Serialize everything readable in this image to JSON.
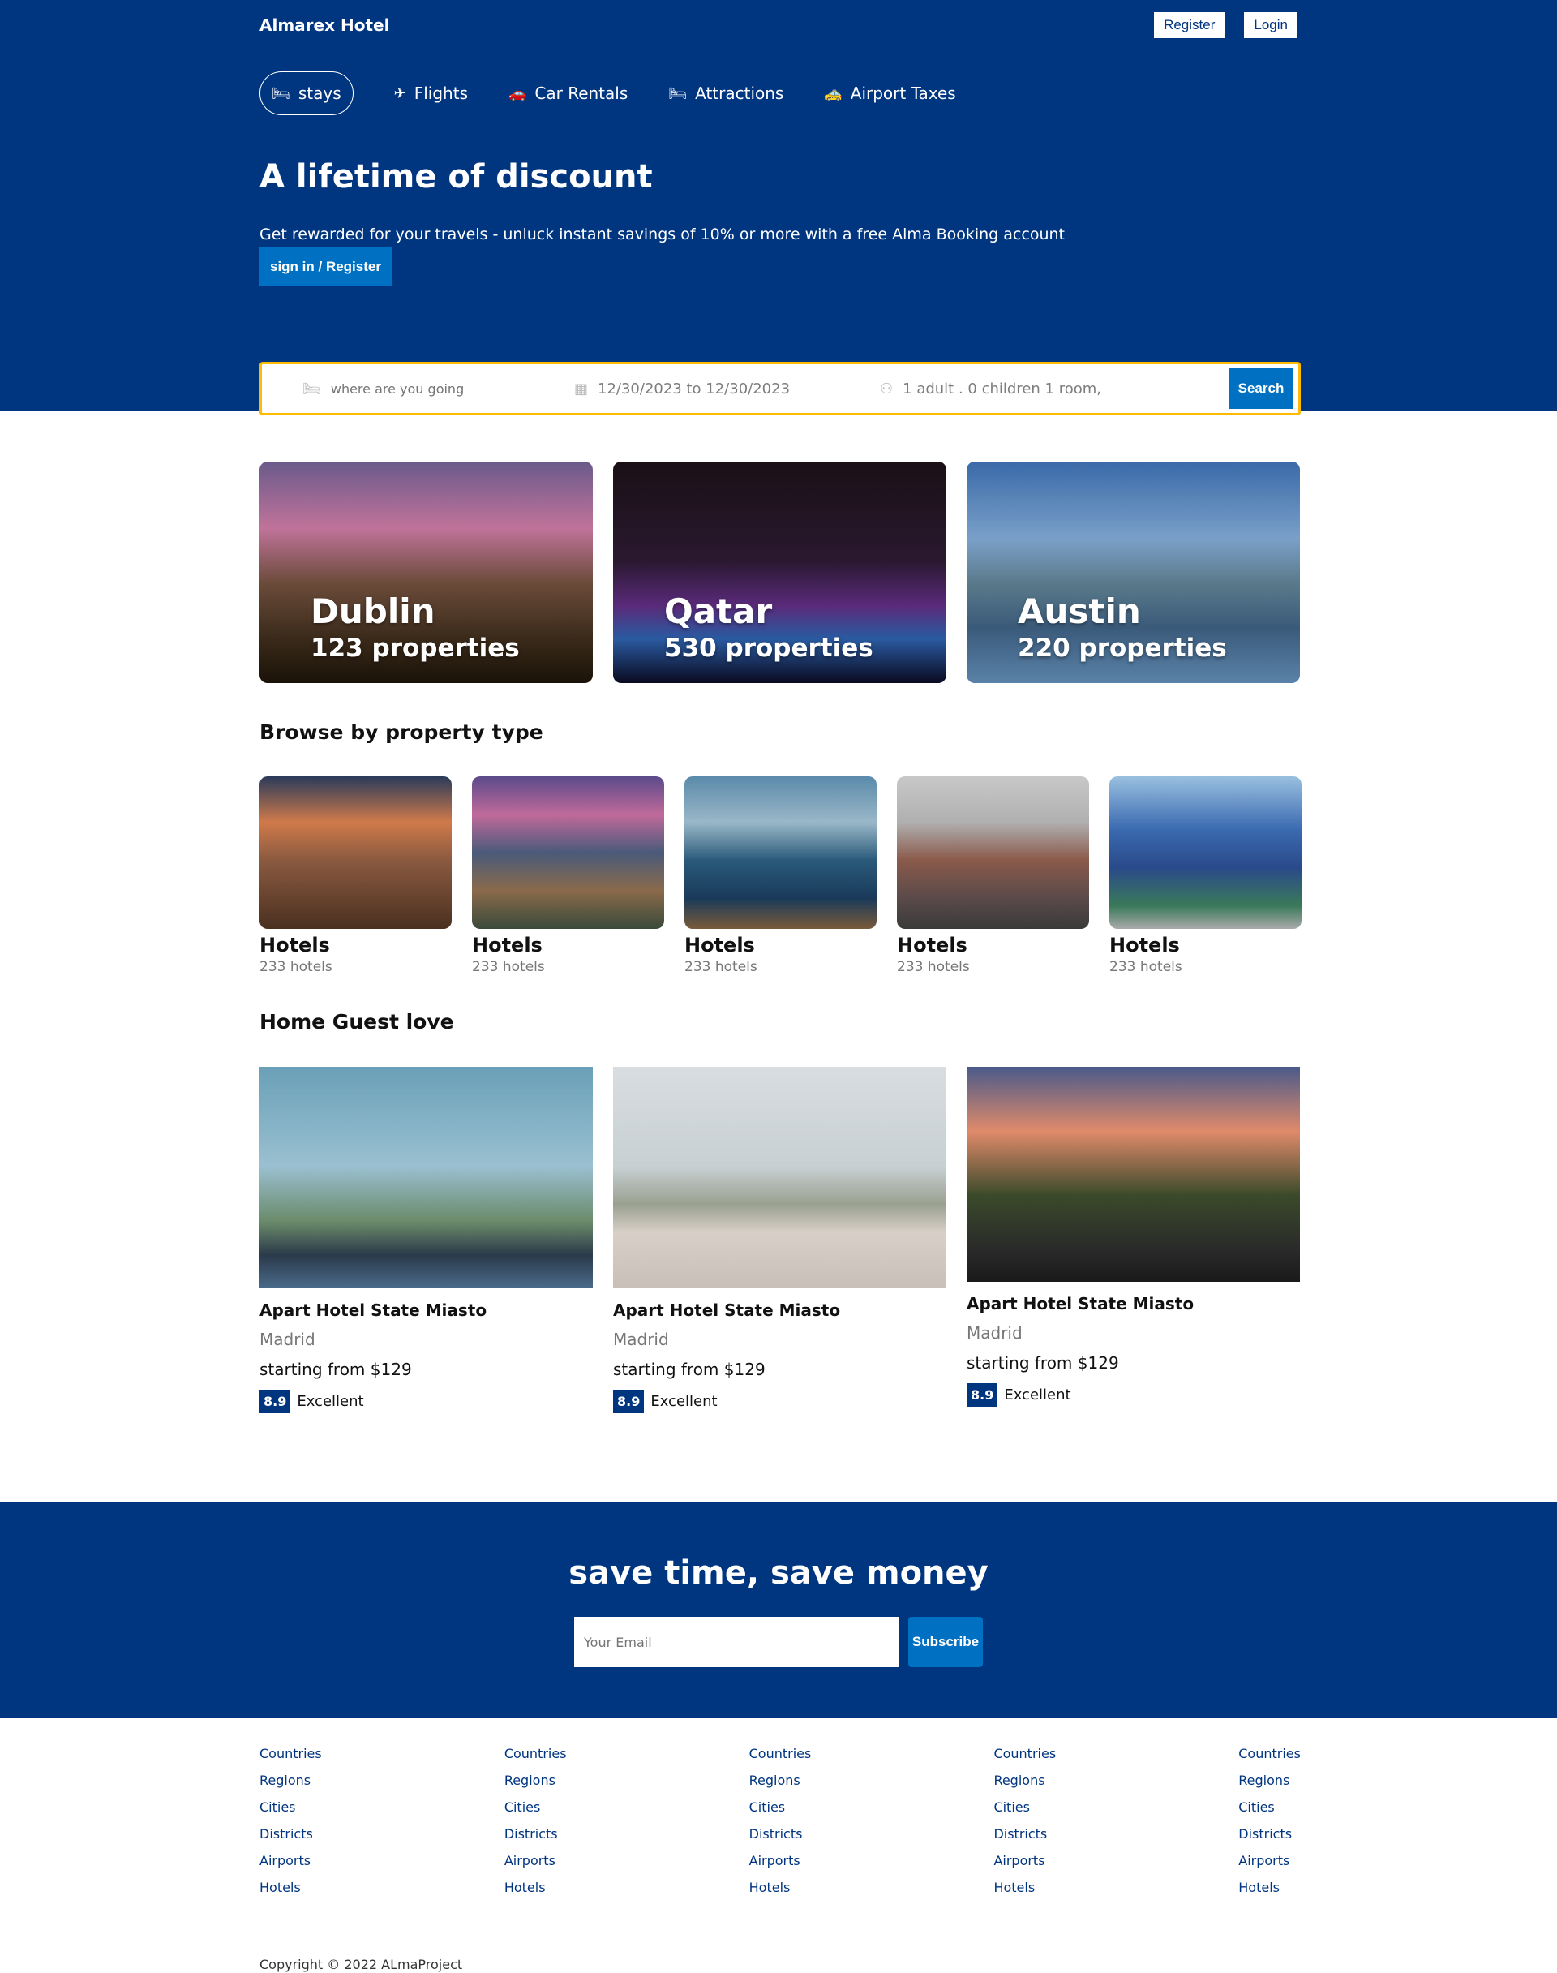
{
  "brand": "Almarex Hotel",
  "auth": {
    "register": "Register",
    "login": "Login"
  },
  "nav": [
    {
      "label": "stays",
      "icon": "bed-icon",
      "active": true
    },
    {
      "label": "Flights",
      "icon": "plane-icon"
    },
    {
      "label": "Car Rentals",
      "icon": "car-icon"
    },
    {
      "label": "Attractions",
      "icon": "bed-icon"
    },
    {
      "label": "Airport Taxes",
      "icon": "taxi-icon"
    }
  ],
  "hero": {
    "title": "A lifetime of discount",
    "subtitle": "Get rewarded for your travels - unluck instant savings of 10% or more with a free Alma Booking account",
    "cta": "sign in / Register"
  },
  "search": {
    "destination_placeholder": "where are you going",
    "dates": "12/30/2023 to 12/30/2023",
    "guests": "1 adult . 0 children 1 room,",
    "button": "Search"
  },
  "featured": [
    {
      "name": "Dublin",
      "properties": "123 properties"
    },
    {
      "name": "Qatar",
      "properties": "530 properties"
    },
    {
      "name": "Austin",
      "properties": "220 properties"
    }
  ],
  "property_section_title": "Browse by property type",
  "property_types": [
    {
      "title": "Hotels",
      "count": "233 hotels"
    },
    {
      "title": "Hotels",
      "count": "233 hotels"
    },
    {
      "title": "Hotels",
      "count": "233 hotels"
    },
    {
      "title": "Hotels",
      "count": "233 hotels"
    },
    {
      "title": "Hotels",
      "count": "233 hotels"
    }
  ],
  "guest_section_title": "Home Guest love",
  "guest_love": [
    {
      "name": "Apart Hotel State Miasto",
      "city": "Madrid",
      "price": "starting from $129",
      "score": "8.9",
      "rating_text": "Excellent"
    },
    {
      "name": "Apart Hotel State Miasto",
      "city": "Madrid",
      "price": "starting from $129",
      "score": "8.9",
      "rating_text": "Excellent"
    },
    {
      "name": "Apart Hotel State Miasto",
      "city": "Madrid",
      "price": "starting from $129",
      "score": "8.9",
      "rating_text": "Excellent"
    }
  ],
  "newsletter": {
    "title": "save time, save money",
    "placeholder": "Your Email",
    "button": "Subscribe"
  },
  "footer_columns": [
    [
      "Countries",
      "Regions",
      "Cities",
      "Districts",
      "Airports",
      "Hotels"
    ],
    [
      "Countries",
      "Regions",
      "Cities",
      "Districts",
      "Airports",
      "Hotels"
    ],
    [
      "Countries",
      "Regions",
      "Cities",
      "Districts",
      "Airports",
      "Hotels"
    ],
    [
      "Countries",
      "Regions",
      "Cities",
      "Districts",
      "Airports",
      "Hotels"
    ],
    [
      "Countries",
      "Regions",
      "Cities",
      "Districts",
      "Airports",
      "Hotels"
    ]
  ],
  "copyright": "Copyright © 2022 ALmaProject",
  "colors": {
    "primary": "#003580",
    "accent": "#0071c2",
    "search_border": "#febb02"
  }
}
